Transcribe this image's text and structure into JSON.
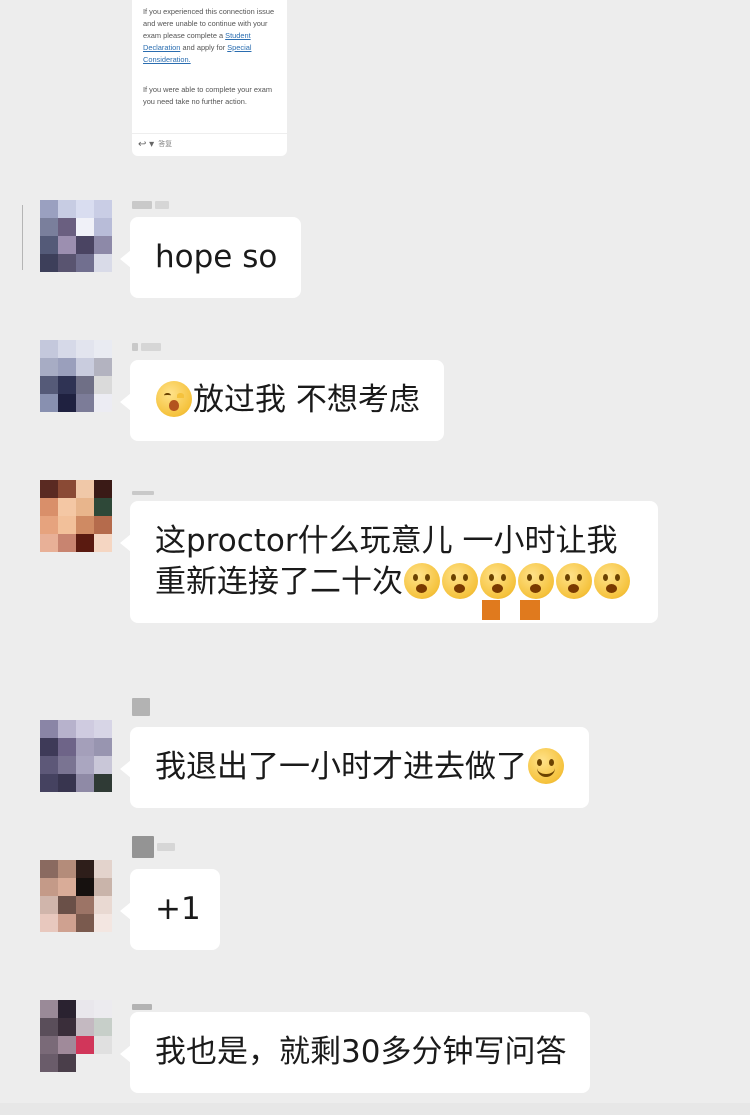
{
  "email": {
    "para1_pre": "If you experienced this connection issue and were unable to continue with your exam please complete a ",
    "link1": "Student Declaration",
    "para1_mid": " and apply for ",
    "link2": "Special Consideration.",
    "para2": "If you were able to complete your exam you need take no further action.",
    "footer_icon": "reply-icon",
    "footer_label": "答复"
  },
  "messages": [
    {
      "text": "hope so"
    },
    {
      "emoji": "kiss-face-emoji",
      "text": "放过我 不想考虑"
    },
    {
      "text": "这proctor什么玩意儿 一小时让我重新连接了二十次"
    },
    {
      "text": "我退出了一小时才进去做了",
      "emoji": "smile-emoji"
    },
    {
      "text": "+1"
    },
    {
      "text": "我也是，就剩30多分钟写问答"
    }
  ],
  "colors": {
    "background": "#ededed",
    "bubble": "#ffffff",
    "link": "#2a6db0",
    "emoji": "#f5c23c"
  }
}
